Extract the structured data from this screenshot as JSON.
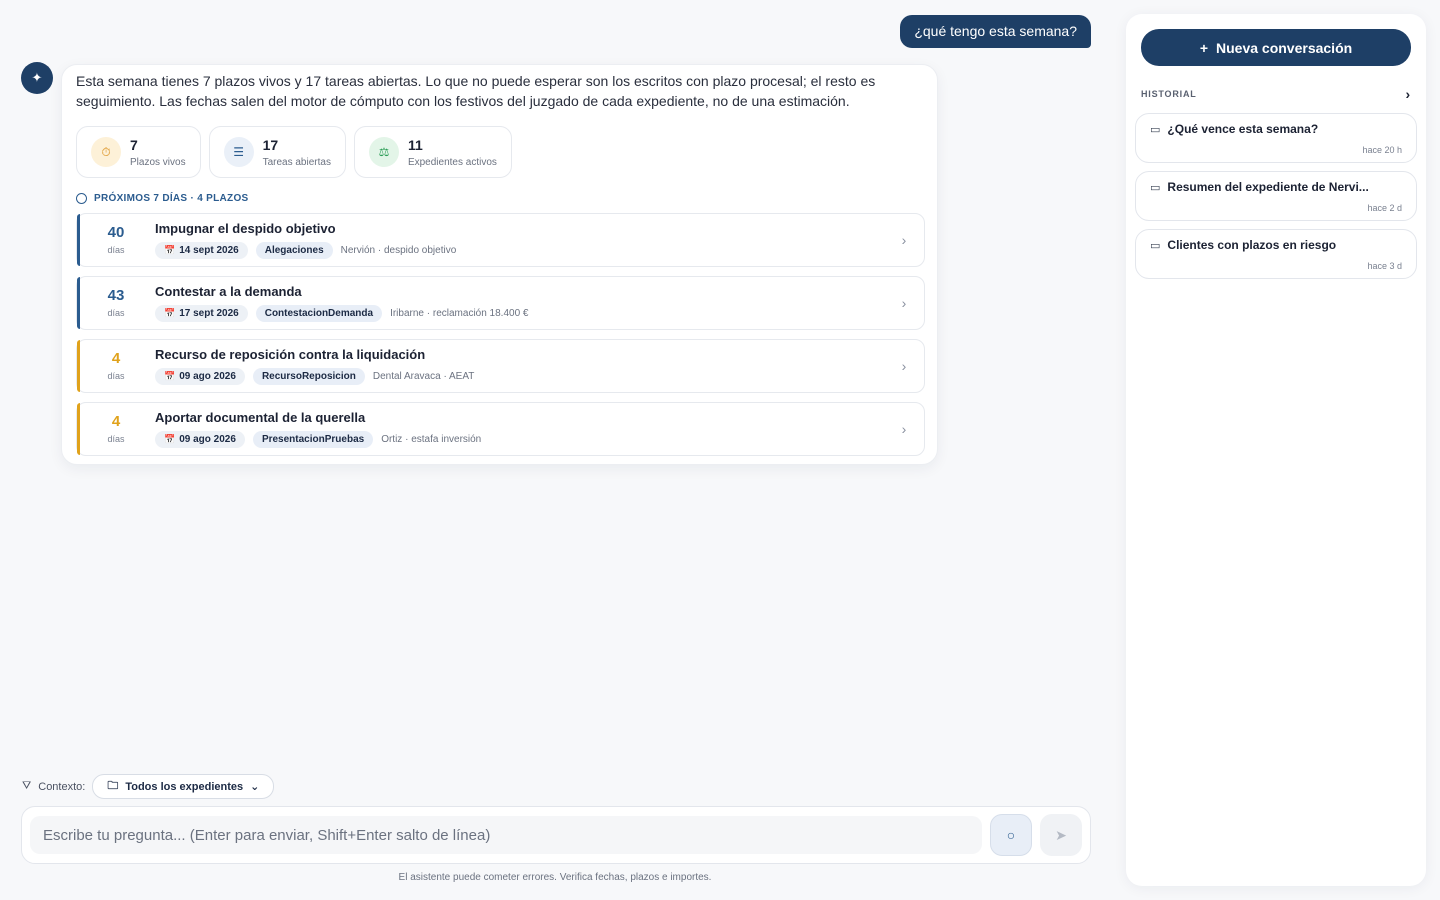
{
  "user_message": "¿qué tengo esta semana?",
  "answer": {
    "text": "Esta semana tienes 7 plazos vivos y 17 tareas abiertas. Lo que no puede esperar son los escritos con plazo procesal; el resto es seguimiento. Las fechas salen del motor de cómputo con los festivos del juzgado de cada expediente, no de una estimación.",
    "stats": [
      {
        "value": "7",
        "label": "Plazos vivos",
        "icon": "stopwatch-icon",
        "bg": "#fdf1d8",
        "fg": "#d98a12"
      },
      {
        "value": "17",
        "label": "Tareas abiertas",
        "icon": "checklist-icon",
        "bg": "#eaf0f8",
        "fg": "#2b5c8f"
      },
      {
        "value": "11",
        "label": "Expedientes activos",
        "icon": "gavel-icon",
        "bg": "#e3f5e8",
        "fg": "#2a9d55"
      }
    ],
    "next_header": "PRÓXIMOS 7 DÍAS · 4 PLAZOS",
    "deadlines": [
      {
        "days": "40",
        "unit": "días",
        "title": "Impugnar el despido objetivo",
        "date": "14 sept 2026",
        "tag": "Alegaciones",
        "desc": "Nervión · despido objetivo",
        "color": "#2b5c8f"
      },
      {
        "days": "43",
        "unit": "días",
        "title": "Contestar a la demanda",
        "date": "17 sept 2026",
        "tag": "ContestacionDemanda",
        "desc": "Iribarne · reclamación 18.400 €",
        "color": "#2b5c8f"
      },
      {
        "days": "4",
        "unit": "días",
        "title": "Recurso de reposición contra la liquidación",
        "date": "09 ago 2026",
        "tag": "RecursoReposicion",
        "desc": "Dental Aravaca · AEAT",
        "color": "#e0a21b"
      },
      {
        "days": "4",
        "unit": "días",
        "title": "Aportar documental de la querella",
        "date": "09 ago 2026",
        "tag": "PresentacionPruebas",
        "desc": "Ortiz · estafa inversión",
        "color": "#e0a21b"
      }
    ]
  },
  "composer": {
    "context_label": "Contexto:",
    "context_value": "Todos los expedientes",
    "placeholder": "Escribe tu pregunta... (Enter para enviar, Shift+Enter salto de línea)",
    "disclaimer": "El asistente puede cometer errores. Verifica fechas, plazos e importes."
  },
  "sidebar": {
    "new_button": "Nueva conversación",
    "history_label": "HISTORIAL",
    "history": [
      {
        "title": "¿Qué vence esta semana?",
        "time": "hace 20 h"
      },
      {
        "title": "Resumen del expediente de Nervi...",
        "time": "hace 2 d"
      },
      {
        "title": "Clientes con plazos en riesgo",
        "time": "hace 3 d"
      }
    ]
  }
}
